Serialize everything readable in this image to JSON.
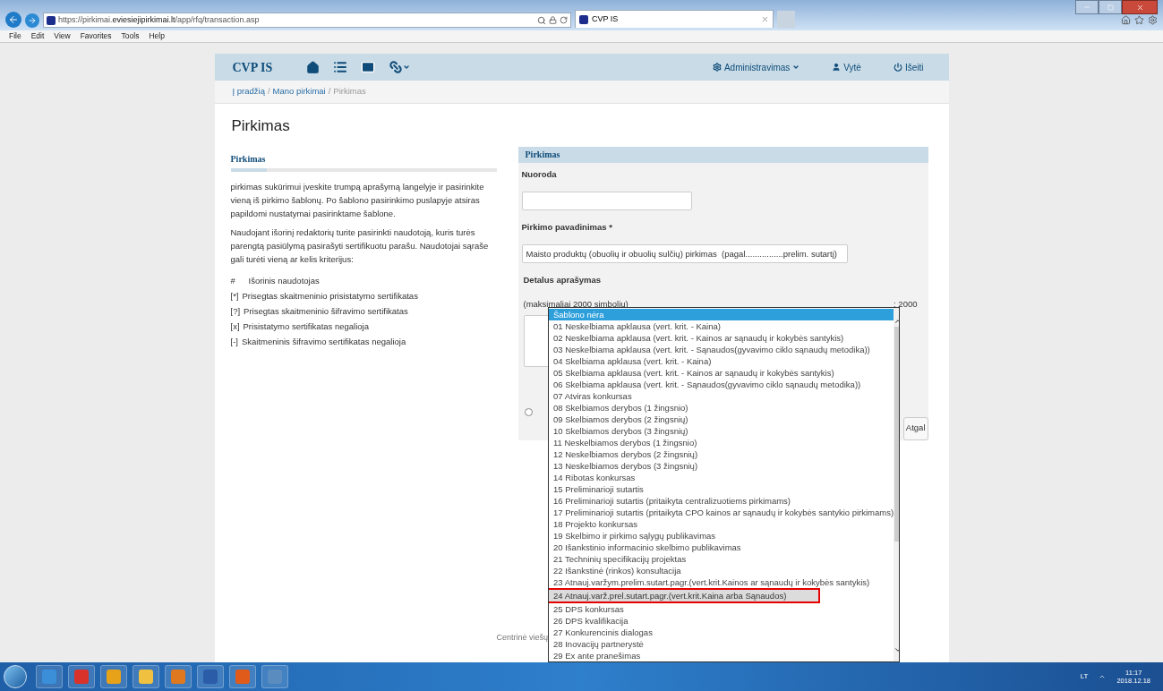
{
  "browser": {
    "url_prefix": "https://pirkimai.",
    "url_domain": "eviesiejipirkimai.lt",
    "url_path": "/app/rfq/transaction.asp",
    "tab_title": "CVP IS",
    "menu": [
      "File",
      "Edit",
      "View",
      "Favorites",
      "Tools",
      "Help"
    ]
  },
  "navbar": {
    "brand": "CVP IS",
    "admin": "Administravimas",
    "user": "Vytė",
    "logout": "Išeiti"
  },
  "breadcrumb": {
    "links": [
      "Į pradžią",
      "Mano pirkimai"
    ],
    "current": "Pirkimas",
    "separator": "/"
  },
  "page_title": "Pirkimas",
  "help": {
    "title": "Pirkimas",
    "paragraphs": [
      "pirkimas sukūrimui įveskite trumpą aprašymą langelyje ir pasirinkite vieną iš pirkimo šablonų. Po šablono pasirinkimo puslapyje atsiras papildomi nustatymai pasirinktame šablone.",
      "Naudojant išorinį redaktorių turite pasirinkti naudotoją, kuris turės parengtą pasiūlymą pasirašyti sertifikuotu parašu. Naudotojai sąraše gali turėti vieną ar kelis kriterijus:"
    ],
    "legend": [
      {
        "mark": "#",
        "text": "Išorinis naudotojas"
      },
      {
        "mark": "[*]",
        "text": "Prisegtas skaitmeninio prisistatymo sertifikatas"
      },
      {
        "mark": "[?]",
        "text": "Prisegtas skaitmeninio šifravimo sertifikatas"
      },
      {
        "mark": "[x]",
        "text": "Prisistatymo sertifikatas negalioja"
      },
      {
        "mark": "[-]",
        "text": "Skaitmeninis šifravimo sertifikatas negalioja"
      }
    ]
  },
  "form": {
    "title": "Pirkimas",
    "reference_label": "Nuoroda",
    "name_label": "Pirkimo pavadinimas *",
    "name_value": "Maisto produktų (obuolių ir obuolių sulčių) pirkimas  (pagal................prelim. sutartį)",
    "description_label": "Detalus aprašymas",
    "description_hint": "(maksimaliai 2000 simbolių)",
    "counter": ": 2000",
    "radio_selected": false,
    "back_button": "Atgal"
  },
  "footer": "Centrinė viešų",
  "template_dropdown": {
    "items": [
      {
        "text": "Šablono nėra",
        "selected": true,
        "highlighted": false
      },
      {
        "text": "01 Neskelbiama apklausa (vert. krit. - Kaina)",
        "selected": false,
        "highlighted": false
      },
      {
        "text": "02 Neskelbiama apklausa (vert. krit. - Kainos ar sąnaudų ir kokybės santykis)",
        "selected": false,
        "highlighted": false
      },
      {
        "text": "03 Neskelbiama apklausa (vert. krit. - Sąnaudos(gyvavimo ciklo sąnaudų metodika))",
        "selected": false,
        "highlighted": false
      },
      {
        "text": "04 Skelbiama apklausa (vert. krit. - Kaina)",
        "selected": false,
        "highlighted": false
      },
      {
        "text": "05 Skelbiama apklausa (vert. krit. - Kainos ar sąnaudų ir kokybės santykis)",
        "selected": false,
        "highlighted": false
      },
      {
        "text": "06 Skelbiama apklausa (vert. krit. - Sąnaudos(gyvavimo ciklo sąnaudų metodika))",
        "selected": false,
        "highlighted": false
      },
      {
        "text": "07 Atviras konkursas",
        "selected": false,
        "highlighted": false
      },
      {
        "text": "08 Skelbiamos derybos (1 žingsnio)",
        "selected": false,
        "highlighted": false
      },
      {
        "text": "09 Skelbiamos derybos (2 žingsnių)",
        "selected": false,
        "highlighted": false
      },
      {
        "text": "10 Skelbiamos derybos (3 žingsnių)",
        "selected": false,
        "highlighted": false
      },
      {
        "text": "11 Neskelbiamos derybos (1 žingsnio)",
        "selected": false,
        "highlighted": false
      },
      {
        "text": "12 Neskelbiamos derybos (2 žingsnių)",
        "selected": false,
        "highlighted": false
      },
      {
        "text": "13 Neskelbiamos derybos (3 žingsnių)",
        "selected": false,
        "highlighted": false
      },
      {
        "text": "14 Ribotas konkursas",
        "selected": false,
        "highlighted": false
      },
      {
        "text": "15 Preliminarioji sutartis",
        "selected": false,
        "highlighted": false
      },
      {
        "text": "16 Preliminarioji sutartis (pritaikyta centralizuotiems pirkimams)",
        "selected": false,
        "highlighted": false
      },
      {
        "text": "17 Preliminarioji sutartis (pritaikyta CPO kainos ar sąnaudų ir kokybės santykio pirkimams)",
        "selected": false,
        "highlighted": false
      },
      {
        "text": "18 Projekto konkursas",
        "selected": false,
        "highlighted": false
      },
      {
        "text": "19 Skelbimo ir pirkimo sąlygų publikavimas",
        "selected": false,
        "highlighted": false
      },
      {
        "text": "20 Išankstinio informacinio skelbimo publikavimas",
        "selected": false,
        "highlighted": false
      },
      {
        "text": "21 Techninių specifikacijų projektas",
        "selected": false,
        "highlighted": false
      },
      {
        "text": "22 Išankstinė (rinkos) konsultacija",
        "selected": false,
        "highlighted": false
      },
      {
        "text": "23 Atnauj.varžym.prelim.sutart.pagr.(vert.krit.Kainos ar sąnaudų ir kokybės santykis)",
        "selected": false,
        "highlighted": false
      },
      {
        "text": "24 Atnauj.varž.prel.sutart.pagr.(vert.krit.Kaina arba Sąnaudos)",
        "selected": false,
        "highlighted": true
      },
      {
        "text": "25 DPS konkursas",
        "selected": false,
        "highlighted": false
      },
      {
        "text": "26 DPS kvalifikacija",
        "selected": false,
        "highlighted": false
      },
      {
        "text": "27 Konkurencinis dialogas",
        "selected": false,
        "highlighted": false
      },
      {
        "text": "28 Inovacijų partnerystė",
        "selected": false,
        "highlighted": false
      },
      {
        "text": "29 Ex ante pranešimas",
        "selected": false,
        "highlighted": false
      }
    ]
  },
  "taskbar": {
    "language": "LT",
    "time": "11:17",
    "date": "2018.12.18"
  }
}
